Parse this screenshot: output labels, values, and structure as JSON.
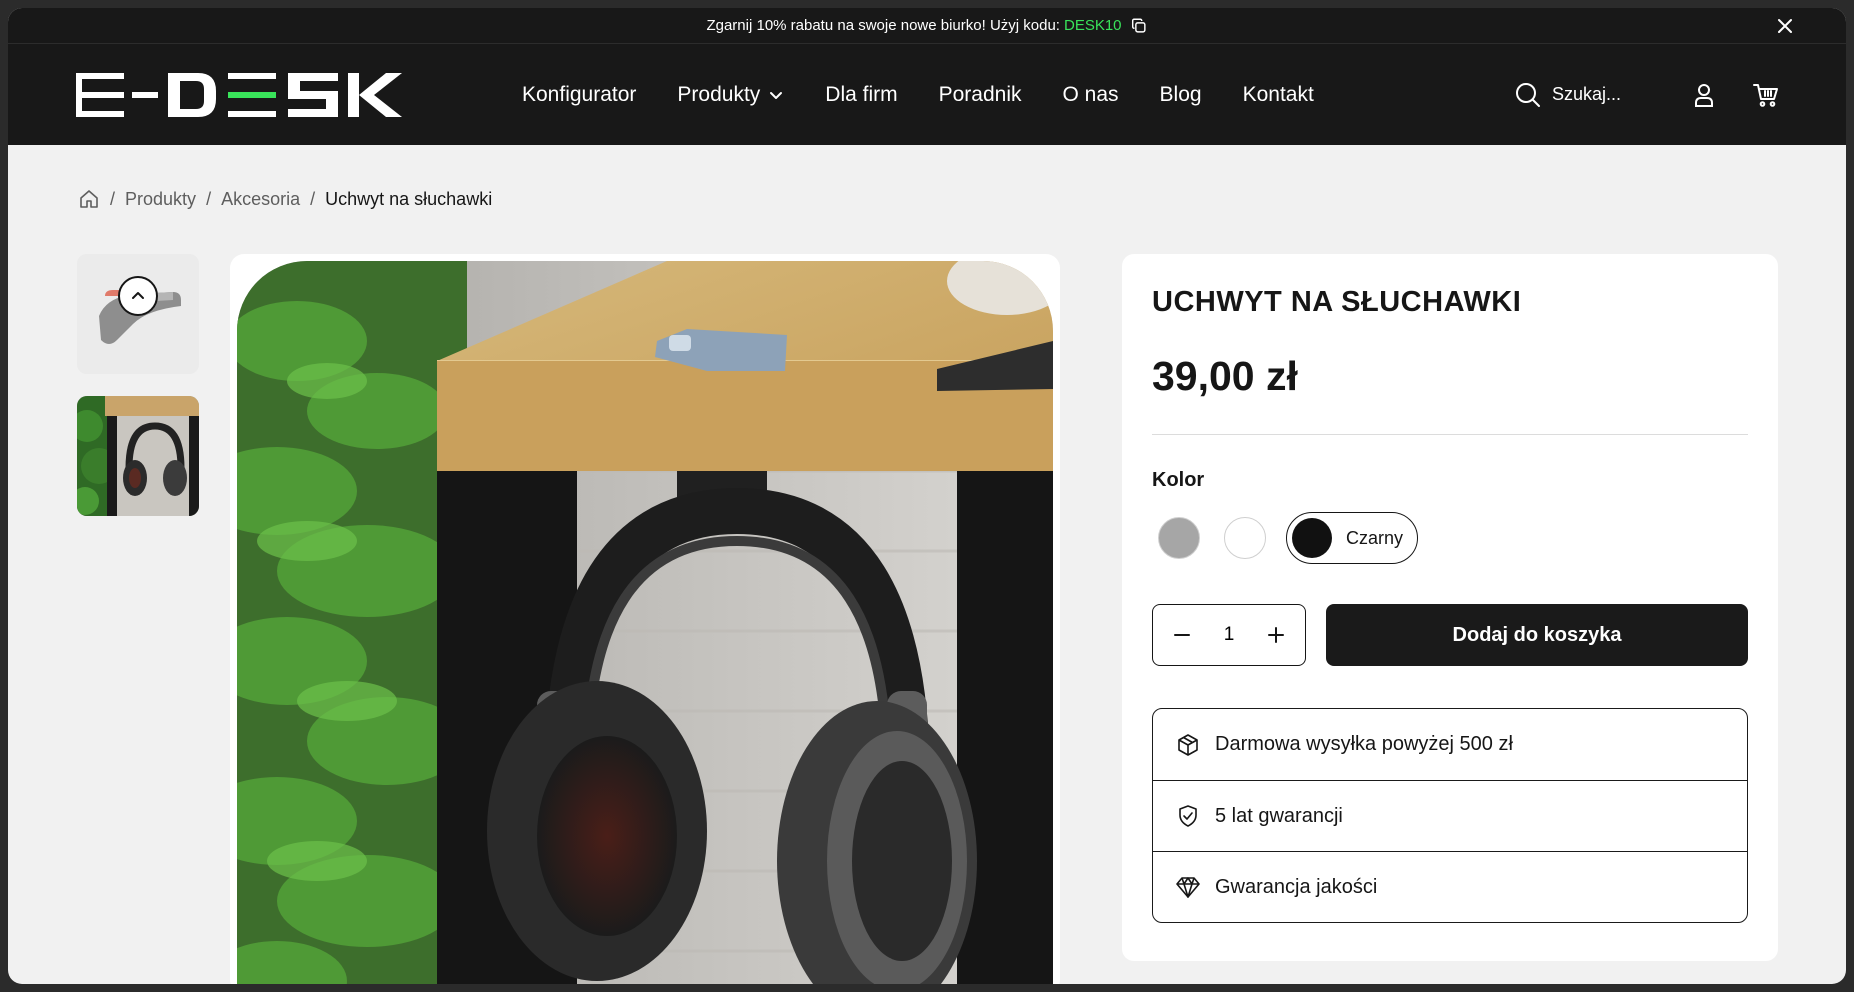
{
  "promo": {
    "text": "Zgarnij 10% rabatu na swoje nowe biurko! Użyj kodu:",
    "code": "DESK10"
  },
  "header": {
    "logo_text": "E-DESK",
    "nav": [
      {
        "label": "Konfigurator"
      },
      {
        "label": "Produkty",
        "has_dropdown": true
      },
      {
        "label": "Dla firm"
      },
      {
        "label": "Poradnik"
      },
      {
        "label": "O nas"
      },
      {
        "label": "Blog"
      },
      {
        "label": "Kontakt"
      }
    ],
    "search_placeholder": "Szukaj..."
  },
  "breadcrumb": {
    "items": [
      "Produkty",
      "Akcesoria"
    ],
    "current": "Uchwyt na słuchawki"
  },
  "product": {
    "title": "UCHWYT NA SŁUCHAWKI",
    "price": "39,00 zł",
    "color_label": "Kolor",
    "colors": [
      {
        "name": "gray",
        "hex": "#a6a6a6"
      },
      {
        "name": "white",
        "hex": "#ffffff"
      },
      {
        "name": "Czarny",
        "hex": "#111111",
        "selected": true
      }
    ],
    "selected_color_label": "Czarny",
    "quantity": "1",
    "add_to_cart": "Dodaj do koszyka",
    "features": [
      {
        "icon": "package-icon",
        "text": "Darmowa wysyłka powyżej 500 zł"
      },
      {
        "icon": "shield-check-icon",
        "text": "5 lat gwarancji"
      },
      {
        "icon": "diamond-icon",
        "text": "Gwarancja jakości"
      }
    ]
  },
  "colors": {
    "dark": "#181818",
    "accent": "#39e35a",
    "page_bg": "#f1f1f1"
  }
}
